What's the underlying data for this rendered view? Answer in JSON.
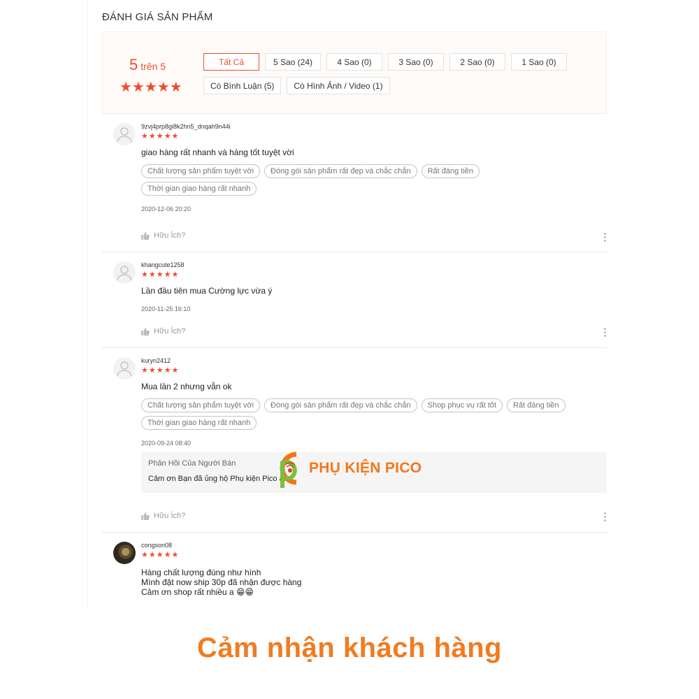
{
  "section_title": "ĐÁNH GIÁ SẢN PHẨM",
  "overview": {
    "score_big": "5",
    "score_small": "trên 5",
    "rating": 5,
    "stars": "★★★★★",
    "filters_row1": [
      "Tất Cả",
      "5 Sao (24)",
      "4 Sao (0)",
      "3 Sao (0)",
      "2 Sao (0)",
      "1 Sao (0)"
    ],
    "filters_row2": [
      "Có Bình Luận (5)",
      "Có Hình Ảnh / Video (1)"
    ]
  },
  "helpful_label": "Hữu Ích?",
  "reviews": [
    {
      "username": "9zvj4prp8gi8k2hn5_dnqah9n44i",
      "rating": 5,
      "stars": "★★★★★",
      "text": "giao hàng rất nhanh và hàng tốt tuyệt vời",
      "tags": [
        "Chất lượng sản phẩm tuyệt vời",
        "Đóng gói sản phẩm rất đẹp và chắc chắn",
        "Rất đáng tiền",
        "Thời gian giao hàng rất nhanh"
      ],
      "date": "2020-12-06 20:20"
    },
    {
      "username": "khangcute1258",
      "rating": 5,
      "stars": "★★★★★",
      "text": "Lần đầu tiên mua Cường lực vừa ý",
      "date": "2020-11-25 16:10"
    },
    {
      "username": "kuryn2412",
      "rating": 5,
      "stars": "★★★★★",
      "text": "Mua lần 2 nhưng vẫn ok",
      "tags": [
        "Chất lượng sản phẩm tuyệt vời",
        "Đóng gói sản phẩm rất đẹp và chắc chắn",
        "Shop phục vụ rất tốt",
        "Rất đáng tiền",
        "Thời gian giao hàng rất nhanh"
      ],
      "date": "2020-09-24 08:40",
      "seller_title": "Phản Hồi Của Người Bán",
      "seller_text": "Cảm ơn Bạn đã ủng hộ Phụ kiện Pico ạ!"
    },
    {
      "username": "congson08",
      "rating": 5,
      "stars": "★★★★★",
      "text_lines": [
        "Hàng chất lượng đúng như hình",
        "Mình đặt now ship 30p đã nhận được hàng",
        "Cảm ơn shop rất nhiều a 😁😁"
      ]
    }
  ],
  "watermark": "PHỤ KIỆN PICO",
  "caption": "Cảm nhận khách hàng",
  "colors": {
    "accent": "#ee4d2d",
    "brand_orange": "#f07c22"
  }
}
